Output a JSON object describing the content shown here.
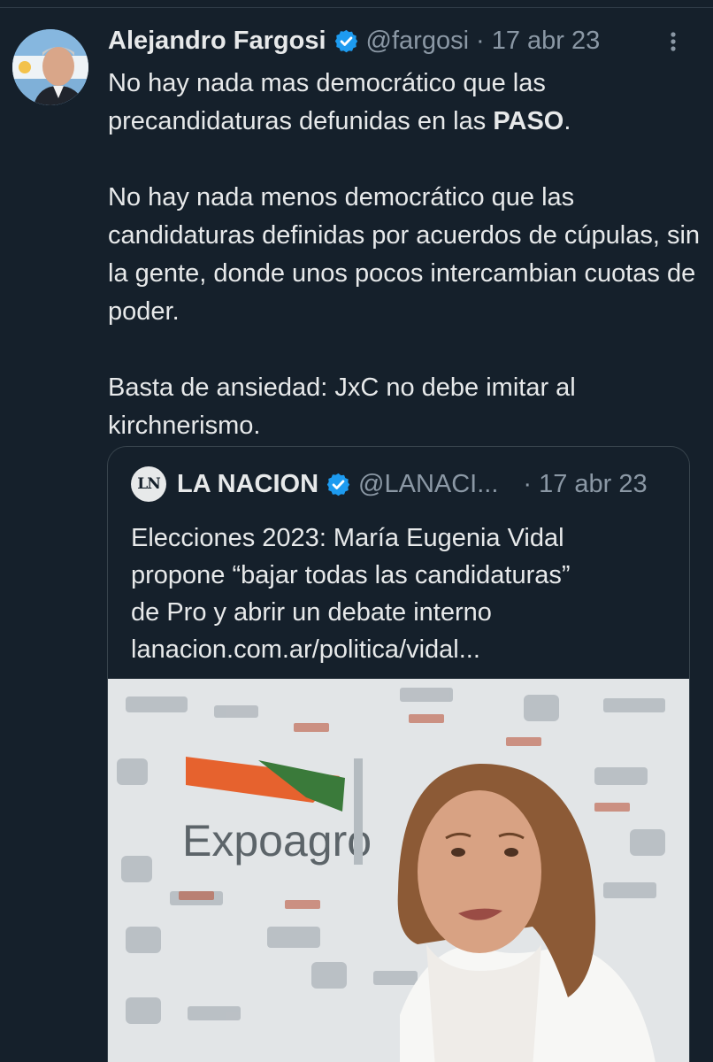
{
  "tweet": {
    "author_name": "Alejandro Fargosi",
    "handle": "@fargosi",
    "separator": "·",
    "date": "17 abr 23",
    "para1_part1": "No hay nada mas democrático que las precandidaturas defunidas en las ",
    "para1_bold": "PASO",
    "para1_part2": ".",
    "para2": "No hay nada menos democrático que las candidaturas definidas por acuerdos de cúpulas, sin la gente, donde unos pocos intercambian cuotas de poder.",
    "para3": "Basta de ansiedad: JxC no debe imitar al kirchnerismo."
  },
  "quote": {
    "logo_text": "LN",
    "name": "LA NACION",
    "handle": "@LANACI...",
    "separator": "·",
    "date": "17 abr 23",
    "text_line1": "Elecciones 2023: María Eugenia Vidal",
    "text_line2": "propone “bajar todas las candidaturas”",
    "text_line3": "de Pro y abrir un debate interno",
    "link": "lanacion.com.ar/politica/vidal...",
    "image_logo_text": "Expoagro"
  },
  "icons": {
    "verified": "verified-badge-icon",
    "more": "more-options-icon"
  },
  "colors": {
    "background": "#15202b",
    "text_primary": "#e7e9ea",
    "text_secondary": "#8b98a5",
    "verified_blue": "#1d9bf0",
    "border": "#38444d"
  }
}
